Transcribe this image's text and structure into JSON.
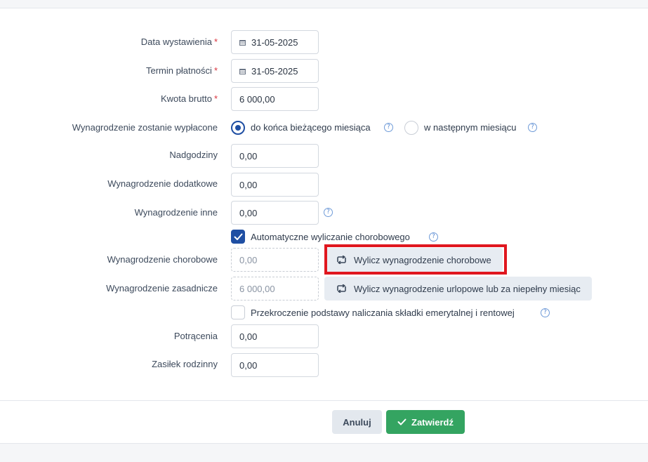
{
  "form": {
    "data_wystawienia": {
      "label": "Data wystawienia",
      "required_mark": "*",
      "value": "31-05-2025",
      "icon": "calendar-icon"
    },
    "termin_platnosci": {
      "label": "Termin płatności",
      "required_mark": "*",
      "value": "31-05-2025",
      "icon": "calendar-icon"
    },
    "kwota_brutto": {
      "label": "Kwota brutto",
      "required_mark": "*",
      "value": "6 000,00"
    },
    "wyplata": {
      "label": "Wynagrodzenie zostanie wypłacone",
      "options": [
        {
          "label": "do końca bieżącego miesiąca",
          "checked": true
        },
        {
          "label": "w następnym miesiącu",
          "checked": false
        }
      ]
    },
    "nadgodziny": {
      "label": "Nadgodziny",
      "value": "0,00"
    },
    "wyn_dodatkowe": {
      "label": "Wynagrodzenie dodatkowe",
      "value": "0,00"
    },
    "wyn_inne": {
      "label": "Wynagrodzenie inne",
      "value": "0,00"
    },
    "auto_chorobowe": {
      "label": "Automatyczne wyliczanie chorobowego",
      "checked": true
    },
    "wyn_chorobowe": {
      "label": "Wynagrodzenie chorobowe",
      "value": "0,00",
      "button": "Wylicz wynagrodzenie chorobowe"
    },
    "wyn_zasadnicze": {
      "label": "Wynagrodzenie zasadnicze",
      "value": "6 000,00",
      "button": "Wylicz wynagrodzenie urlopowe lub za niepełny miesiąc"
    },
    "przekroczenie": {
      "label": "Przekroczenie podstawy naliczania składki emerytalnej i rentowej",
      "checked": false
    },
    "potracenia": {
      "label": "Potrącenia",
      "value": "0,00"
    },
    "zasilek": {
      "label": "Zasiłek rodzinny",
      "value": "0,00"
    }
  },
  "help_glyph": "?",
  "footer": {
    "cancel": "Anuluj",
    "confirm": "Zatwierdź"
  },
  "colors": {
    "primary": "#1f4fa3",
    "success": "#34a461",
    "required": "#d9353f",
    "highlight": "#e0171f"
  }
}
